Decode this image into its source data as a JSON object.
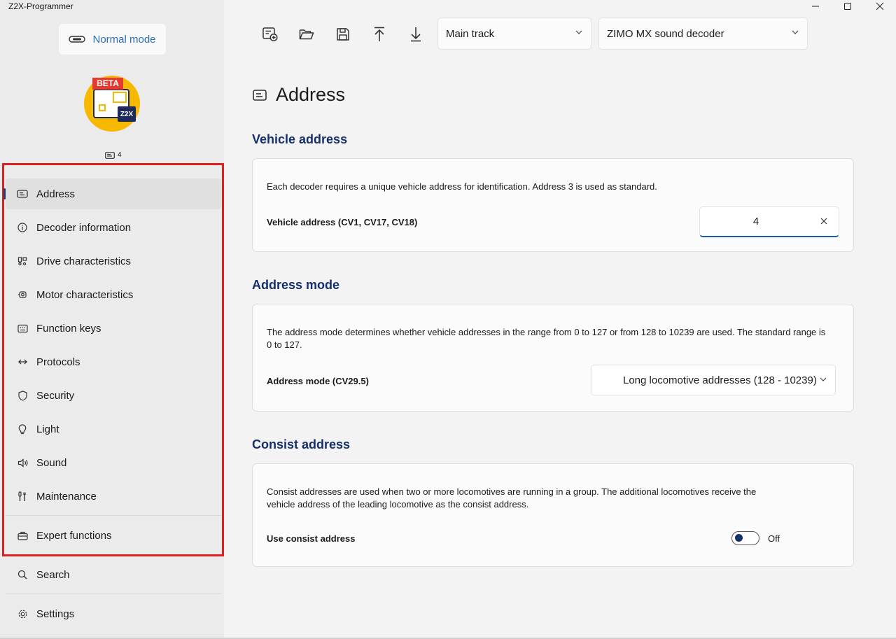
{
  "app": {
    "title": "Z2X-Programmer"
  },
  "sidebar": {
    "mode_button": "Normal mode",
    "logo": {
      "badge": "BETA",
      "tag": "Z2X"
    },
    "current_address": "4",
    "items": [
      {
        "label": "Address",
        "icon": "address-card-icon",
        "active": true
      },
      {
        "label": "Decoder information",
        "icon": "info-icon"
      },
      {
        "label": "Drive characteristics",
        "icon": "drive-icon"
      },
      {
        "label": "Motor characteristics",
        "icon": "motor-icon"
      },
      {
        "label": "Function keys",
        "icon": "keyboard-icon"
      },
      {
        "label": "Protocols",
        "icon": "arrows-icon"
      },
      {
        "label": "Security",
        "icon": "shield-icon"
      },
      {
        "label": "Light",
        "icon": "lightbulb-icon"
      },
      {
        "label": "Sound",
        "icon": "speaker-icon"
      },
      {
        "label": "Maintenance",
        "icon": "tools-icon"
      },
      {
        "label": "Expert functions",
        "icon": "briefcase-icon"
      }
    ],
    "search": "Search",
    "settings": "Settings"
  },
  "toolbar": {
    "track": "Main track",
    "decoder": "ZIMO MX sound decoder",
    "buttons": [
      "new-project-icon",
      "open-folder-icon",
      "save-icon",
      "upload-icon",
      "download-icon"
    ]
  },
  "main": {
    "title": "Address",
    "vehicle": {
      "title": "Vehicle address",
      "description": "Each decoder requires a unique vehicle address for identification. Address 3 is used as standard.",
      "label": "Vehicle address (CV1, CV17, CV18)",
      "value": "4"
    },
    "mode": {
      "title": "Address mode",
      "description": "The address mode determines whether vehicle addresses in the range from 0 to 127 or from 128 to 10239 are used. The standard range is 0 to 127.",
      "label": "Address mode (CV29.5)",
      "value": "Long locomotive addresses (128 - 10239)"
    },
    "consist": {
      "title": "Consist address",
      "description": "Consist addresses are used when two or more locomotives are running in a group. The additional locomotives receive the vehicle address of the leading locomotive as the consist address.",
      "label": "Use consist address",
      "toggle_state": "Off"
    }
  },
  "colors": {
    "accent": "#16306b",
    "highlight_box": "#e02020",
    "mode_text": "#2a6fb8"
  }
}
